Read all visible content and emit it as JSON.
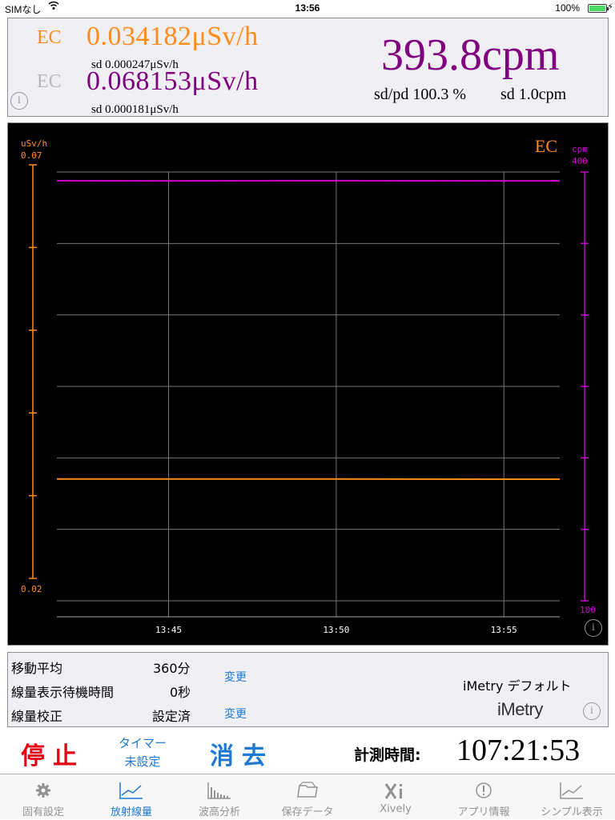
{
  "status_bar": {
    "carrier": "SIMなし",
    "time": "13:56",
    "battery": "100%"
  },
  "readout": {
    "ec1": {
      "label": "EC",
      "dose": "0.034182μSv/h",
      "sd": "sd 0.000247μSv/h"
    },
    "ec2": {
      "label": "EC",
      "dose": "0.068153μSv/h",
      "sd": "sd 0.000181μSv/h"
    },
    "cpm": "393.8cpm",
    "sd_pd": "sd/pd 100.3 %",
    "sd_cpm": "sd 1.0cpm"
  },
  "colors": {
    "dose_orange": "#ff8c1a",
    "cpm_purple": "#800080",
    "cpm_magenta": "#cc00cc",
    "accent_blue": "#1f78d1",
    "stop_red": "#e60012"
  },
  "chart_data": {
    "type": "line",
    "title": "EC",
    "left_axis": {
      "label": "uSv/h",
      "min": 0.02,
      "max": 0.07,
      "top_label": "0.07",
      "bottom_label": "0.02"
    },
    "right_axis": {
      "label": "cpm",
      "min": 100,
      "max": 400,
      "top_label": "400",
      "bottom_label": "100"
    },
    "x_ticks": [
      "13:45",
      "13:50",
      "13:55"
    ],
    "x_range_minutes": [
      "13:41:40",
      "13:56:40"
    ],
    "grid": true,
    "series": [
      {
        "axis": "right",
        "color": "#cc00cc",
        "x": [
          "13:41:40",
          "13:45",
          "13:50",
          "13:55",
          "13:56:40"
        ],
        "values": [
          393.9,
          393.8,
          393.9,
          393.8,
          393.8
        ]
      },
      {
        "axis": "left",
        "color": "#ff8c1a",
        "x": [
          "13:41:40",
          "13:45",
          "13:50",
          "13:55",
          "13:56:40"
        ],
        "values": [
          0.0342,
          0.0342,
          0.0342,
          0.03418,
          0.03418
        ]
      }
    ]
  },
  "settings": {
    "moving_avg_label": "移動平均",
    "moving_avg_value": "360分",
    "wait_label": "線量表示待機時間",
    "wait_value": "0秒",
    "change1": "変更",
    "calib_label": "線量校正",
    "calib_value": "設定済",
    "change2": "変更",
    "preset": "iMetry デフォルト",
    "logo": "iMetry"
  },
  "controls": {
    "stop": "停止",
    "timer_line1": "タイマー",
    "timer_line2": "未設定",
    "clear": "消去",
    "elapsed_label": "計測時間:",
    "elapsed_value": "107:21:53"
  },
  "tabs": [
    {
      "label": "固有設定",
      "icon": "gear-icon"
    },
    {
      "label": "放射線量",
      "icon": "line-chart-icon"
    },
    {
      "label": "波高分析",
      "icon": "histogram-icon"
    },
    {
      "label": "保存データ",
      "icon": "folder-icon"
    },
    {
      "label": "Xively",
      "icon": "xively-icon"
    },
    {
      "label": "アプリ情報",
      "icon": "exclamation-circle-icon"
    },
    {
      "label": "シンプル表示",
      "icon": "simple-chart-icon"
    }
  ],
  "info_glyph": "i"
}
